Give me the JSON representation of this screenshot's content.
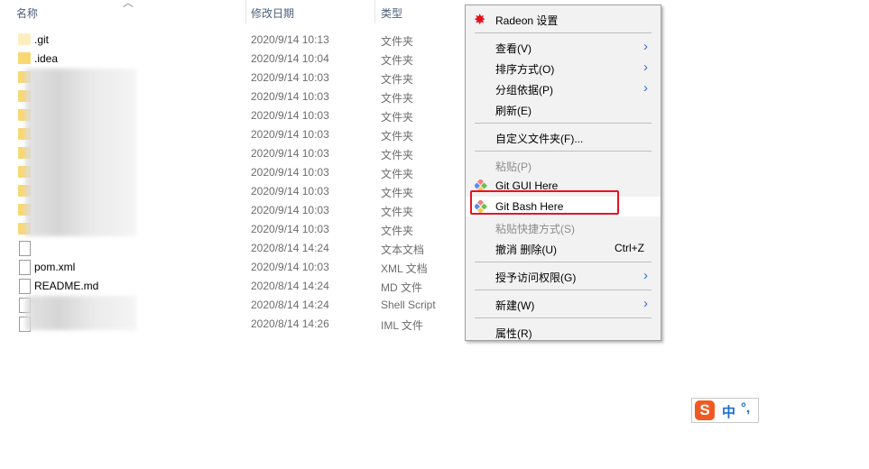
{
  "columns": {
    "name": "名称",
    "date": "修改日期",
    "type": "类型"
  },
  "files": [
    {
      "name": ".git",
      "date": "2020/9/14 10:13",
      "type": "文件夹",
      "kind": "folder-light"
    },
    {
      "name": ".idea",
      "date": "2020/9/14 10:04",
      "type": "文件夹",
      "kind": "folder"
    },
    {
      "name": "",
      "date": "2020/9/14 10:03",
      "type": "文件夹",
      "kind": "folder"
    },
    {
      "name": "",
      "date": "2020/9/14 10:03",
      "type": "文件夹",
      "kind": "folder"
    },
    {
      "name": "",
      "date": "2020/9/14 10:03",
      "type": "文件夹",
      "kind": "folder"
    },
    {
      "name": "",
      "date": "2020/9/14 10:03",
      "type": "文件夹",
      "kind": "folder"
    },
    {
      "name": "",
      "date": "2020/9/14 10:03",
      "type": "文件夹",
      "kind": "folder"
    },
    {
      "name": "",
      "date": "2020/9/14 10:03",
      "type": "文件夹",
      "kind": "folder"
    },
    {
      "name": "",
      "date": "2020/9/14 10:03",
      "type": "文件夹",
      "kind": "folder"
    },
    {
      "name": "",
      "date": "2020/9/14 10:03",
      "type": "文件夹",
      "kind": "folder"
    },
    {
      "name": "",
      "date": "2020/9/14 10:03",
      "type": "文件夹",
      "kind": "folder"
    },
    {
      "name": "",
      "date": "2020/8/14 14:24",
      "type": "文本文档",
      "kind": "doc"
    },
    {
      "name": "pom.xml",
      "date": "2020/9/14 10:03",
      "type": "XML 文档",
      "kind": "doc"
    },
    {
      "name": "README.md",
      "date": "2020/8/14 14:24",
      "type": "MD 文件",
      "kind": "doc"
    },
    {
      "name": "",
      "date": "2020/8/14 14:24",
      "type": "Shell Script",
      "kind": "doc"
    },
    {
      "name": "",
      "date": "2020/8/14 14:26",
      "type": "IML 文件",
      "kind": "doc"
    }
  ],
  "menu": [
    {
      "label": "Radeon 设置",
      "icon": "radeon-icon"
    },
    {
      "sep": true
    },
    {
      "label": "查看(V)",
      "arrow": true
    },
    {
      "label": "排序方式(O)",
      "arrow": true
    },
    {
      "label": "分组依据(P)",
      "arrow": true
    },
    {
      "label": "刷新(E)"
    },
    {
      "sep": true
    },
    {
      "label": "自定义文件夹(F)..."
    },
    {
      "sep": true
    },
    {
      "label": "粘贴(P)",
      "disabled": true
    },
    {
      "label": "Git GUI Here",
      "icon": "git-icon"
    },
    {
      "label": "Git Bash Here",
      "icon": "git-icon",
      "highlighted": true
    },
    {
      "label": "粘贴快捷方式(S)",
      "disabled": true
    },
    {
      "label": "撤消 删除(U)",
      "shortcut": "Ctrl+Z"
    },
    {
      "sep": true
    },
    {
      "label": "授予访问权限(G)",
      "arrow": true
    },
    {
      "sep": true
    },
    {
      "label": "新建(W)",
      "arrow": true
    },
    {
      "sep": true
    },
    {
      "label": "属性(R)"
    }
  ],
  "ime": {
    "mode": "中",
    "punct": "°,",
    "logo": "S"
  },
  "colors": {
    "highlight_box": "#e81123",
    "folder": "#f8d775"
  }
}
